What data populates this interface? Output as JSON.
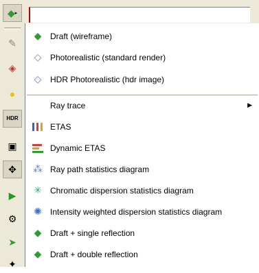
{
  "menu": {
    "items": [
      {
        "label": "Draft (wireframe)",
        "icon": "draft-gem-icon"
      },
      {
        "label": "Photorealistic (standard render)",
        "icon": "photoreal-gem-icon"
      },
      {
        "label": "HDR Photorealistic (hdr image)",
        "icon": "hdr-gem-icon"
      },
      {
        "label": "Ray trace",
        "has_submenu": true
      },
      {
        "label": "ETAS",
        "icon": "etas-icon"
      },
      {
        "label": "Dynamic ETAS",
        "icon": "dynamic-etas-icon"
      },
      {
        "label": "Ray path statistics diagram",
        "icon": "ray-path-icon"
      },
      {
        "label": "Chromatic dispersion statistics diagram",
        "icon": "chromatic-icon"
      },
      {
        "label": "Intensity weighted dispersion statistics diagram",
        "icon": "intensity-icon"
      },
      {
        "label": "Draft + single reflection",
        "icon": "draft-single-icon"
      },
      {
        "label": "Draft + double reflection",
        "icon": "draft-double-icon"
      }
    ]
  },
  "toolbar": {
    "hdr_label": "HDR"
  },
  "colors": {
    "menu_bg": "#ffffff",
    "toolbar_bg": "#ece9d8",
    "accent_red": "#c00000"
  }
}
